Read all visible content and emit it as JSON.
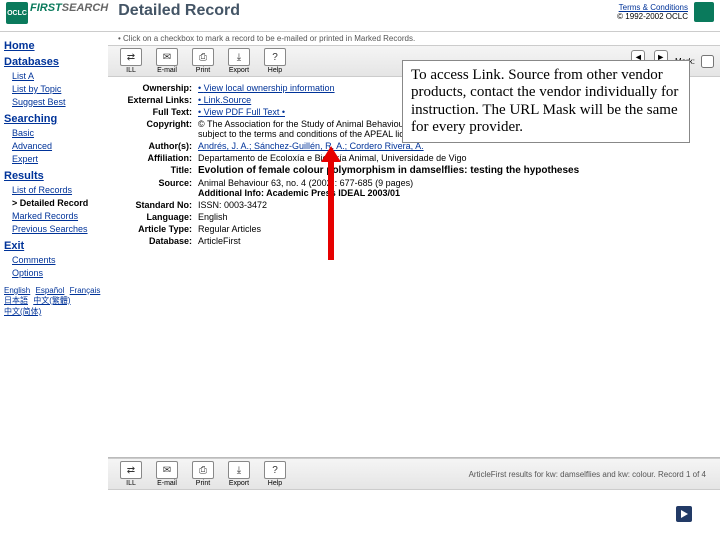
{
  "header": {
    "logo_small": "OCLC",
    "logo_first": "FIRST",
    "logo_search": "SEARCH",
    "page_title": "Detailed Record",
    "terms_link": "Terms & Conditions",
    "copyright": "© 1992-2002 OCLC"
  },
  "sidebar": {
    "home": "Home",
    "databases": "Databases",
    "db_items": [
      "List A",
      "List by Topic",
      "Suggest Best"
    ],
    "searching": "Searching",
    "search_items": [
      "Basic",
      "Advanced",
      "Expert"
    ],
    "results": "Results",
    "result_items": [
      "List of Records",
      "Detailed Record",
      "Marked Records",
      "Previous Searches"
    ],
    "exit": "Exit",
    "exit_items": [
      "Comments",
      "Options"
    ],
    "langs": [
      "English",
      "Español",
      "Français",
      "日本語",
      "中文(繁體)",
      "中文(简体)"
    ]
  },
  "hint": "Click on a checkbox to mark a record to be e-mailed or printed in Marked Records.",
  "toolbar": {
    "items": [
      {
        "icon": "⇄",
        "label": "ILL"
      },
      {
        "icon": "✉",
        "label": "E-mail"
      },
      {
        "icon": "⎙",
        "label": "Print"
      },
      {
        "icon": "⤓",
        "label": "Export"
      },
      {
        "icon": "?",
        "label": "Help"
      }
    ],
    "prev": "Prev",
    "next": "Next",
    "mark": "Mark:"
  },
  "record": {
    "ownership_label": "Ownership:",
    "ownership_link": "View local ownership information",
    "extlinks_label": "External Links:",
    "extlinks_link": "Link.Source",
    "fulltext_label": "Full Text:",
    "fulltext_link": "View PDF Full Text  •",
    "copyright_label": "Copyright:",
    "copyright_text": "© The Association for the Study of Animal Behaviour. Licensed use. Further reproduction prohibited by Academic Press is subject to the terms and conditions of the APEAL license between licensee and Academic Press.",
    "authors_label": "Author(s):",
    "authors_text": "Andrés, J. A.; Sánchez-Guillén, R. A.; Cordero Rivera, A.",
    "affiliation_label": "Affiliation:",
    "affiliation_text": "Departamento de Ecoloxía e Bioloxía Animal, Universidade de Vigo",
    "title_label": "Title:",
    "title_text": "Evolution of female colour polymorphism in damselflies: testing the hypotheses",
    "source_label": "Source:",
    "source_text": "Animal Behaviour 63, no. 4 (2002): 677-685 (9 pages)",
    "addinfo_label": "",
    "addinfo_text": "Additional Info: Academic Press IDEAL  2003/01",
    "stdno_label": "Standard No:",
    "stdno_text": "ISSN: 0003-3472",
    "language_label": "Language:",
    "language_text": "English",
    "arttype_label": "Article Type:",
    "arttype_text": "Regular Articles",
    "database_label": "Database:",
    "database_text": "ArticleFirst"
  },
  "footer_status": "ArticleFirst results for  kw: damselflies and kw: colour. Record 1 of 4",
  "callout": "To access Link. Source from other vendor products, contact the vendor individually for instruction.  The URL Mask will be the same for every provider."
}
